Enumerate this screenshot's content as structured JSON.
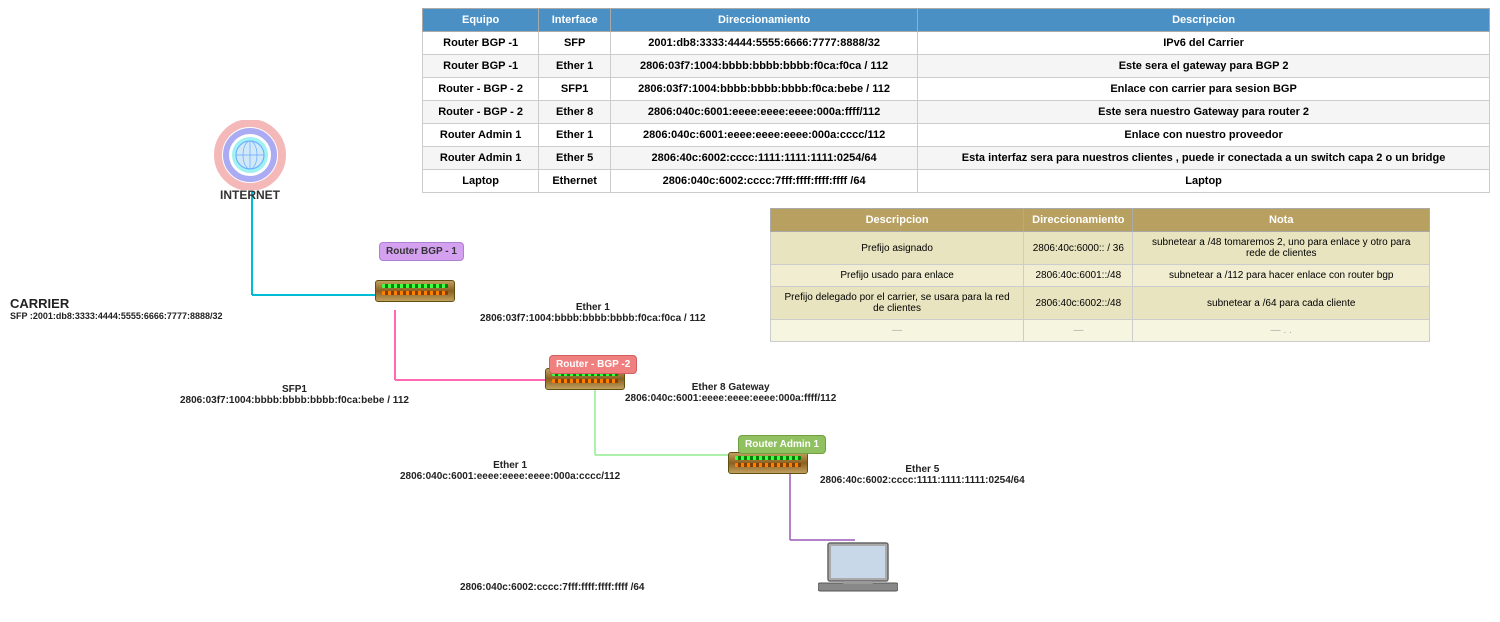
{
  "table1": {
    "headers": [
      "Equipo",
      "Interface",
      "Direccionamiento",
      "Descripcion"
    ],
    "rows": [
      {
        "equipo": "Router BGP -1",
        "interface": "SFP",
        "direccionamiento": "2001:db8:3333:4444:5555:6666:7777:8888/32",
        "descripcion": "IPv6 del Carrier"
      },
      {
        "equipo": "Router BGP -1",
        "interface": "Ether 1",
        "direccionamiento": "2806:03f7:1004:bbbb:bbbb:bbbb:f0ca:f0ca / 112",
        "descripcion": "Este sera el gateway para BGP 2"
      },
      {
        "equipo": "Router - BGP - 2",
        "interface": "SFP1",
        "direccionamiento": "2806:03f7:1004:bbbb:bbbb:bbbb:f0ca:bebe / 112",
        "descripcion": "Enlace con carrier para sesion BGP"
      },
      {
        "equipo": "Router - BGP - 2",
        "interface": "Ether 8",
        "direccionamiento": "2806:040c:6001:eeee:eeee:eeee:000a:ffff/112",
        "descripcion": "Este sera nuestro Gateway para router 2"
      },
      {
        "equipo": "Router Admin 1",
        "interface": "Ether 1",
        "direccionamiento": "2806:040c:6001:eeee:eeee:eeee:000a:cccc/112",
        "descripcion": "Enlace con nuestro proveedor"
      },
      {
        "equipo": "Router Admin 1",
        "interface": "Ether 5",
        "direccionamiento": "2806:40c:6002:cccc:1111:1111:1111:0254/64",
        "descripcion": "Esta interfaz sera para nuestros clientes , puede ir conectada a un switch capa 2 o un bridge"
      },
      {
        "equipo": "Laptop",
        "interface": "Ethernet",
        "direccionamiento": "2806:040c:6002:cccc:7fff:ffff:ffff:ffff /64",
        "descripcion": "Laptop"
      }
    ]
  },
  "table2": {
    "headers": [
      "Descripcion",
      "Direccionamiento",
      "Nota"
    ],
    "rows": [
      {
        "descripcion": "Prefijo asignado",
        "direccionamiento": "2806:40c:6000:: / 36",
        "nota": "subnetear a /48  tomaremos 2, uno para enlace y otro para rede de clientes"
      },
      {
        "descripcion": "Prefijo usado para enlace",
        "direccionamiento": "2806:40c:6001::/48",
        "nota": "subnetear a /112 para hacer enlace con router bgp"
      },
      {
        "descripcion": "Prefijo delegado por el carrier, se usara para la red de clientes",
        "direccionamiento": "2806:40c:6002::/48",
        "nota": "subnetear a /64 para cada cliente"
      },
      {
        "descripcion": "—",
        "direccionamiento": "—",
        "nota": "— . ."
      }
    ]
  },
  "diagram": {
    "internet_label": "INTERNET",
    "carrier_label": "CARRIER",
    "carrier_sfp": "SFP :2001:db8:3333:4444:5555:6666:7777:8888/32",
    "router_bgp1_label": "Router BGP -\n1",
    "ether1_bgp1_label": "Ether 1",
    "ether1_bgp1_addr": "2806:03f7:1004:bbbb:bbbb:bbbb:f0ca:f0ca / 112",
    "router_bgp2_label": "Router - BGP -2",
    "sfp1_label": "SFP1",
    "sfp1_addr": "2806:03f7:1004:bbbb:bbbb:bbbb:f0ca:bebe / 112",
    "ether8_label": "Ether 8 Gateway",
    "ether8_addr": "2806:040c:6001:eeee:eeee:eeee:000a:ffff/112",
    "router_admin1_label": "Router Admin 1",
    "ether1_admin1_label": "Ether 1",
    "ether1_admin1_addr": "2806:040c:6001:eeee:eeee:eeee:000a:cccc/112",
    "ether5_label": "Ether 5",
    "ether5_addr": "2806:40c:6002:cccc:1111:1111:1111:0254/64",
    "laptop_addr": "2806:040c:6002:cccc:7fff:ffff:ffff:ffff /64"
  }
}
